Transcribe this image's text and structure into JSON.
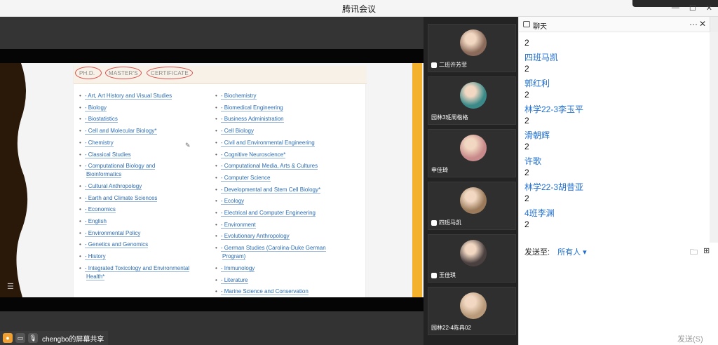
{
  "window": {
    "title": "腾讯会议"
  },
  "slide": {
    "tabs": [
      "PH.D.",
      "MASTER'S",
      "CERTIFICATE"
    ],
    "col1": [
      "- Art, Art History and Visual Studies",
      "- Biology",
      "- Biostatistics",
      "- Cell and Molecular Biology*",
      "- Chemistry",
      "- Classical Studies",
      "- Computational Biology and",
      "Bioinformatics",
      "- Cultural Anthropology",
      "- Earth and Climate Sciences",
      "- Economics",
      "- English",
      "- Environmental Policy",
      "- Genetics and Genomics",
      "- History",
      "- Integrated Toxicology and Environmental",
      "Health*"
    ],
    "col2": [
      "- Biochemistry",
      "- Biomedical Engineering",
      "- Business Administration",
      "- Cell Biology",
      "- Civil and Environmental Engineering",
      "- Cognitive Neuroscience*",
      "- Computational Media, Arts & Cultures",
      "- Computer Science",
      "- Developmental and Stem Cell Biology*",
      "- Ecology",
      "- Electrical and Computer Engineering",
      "- Environment",
      "- Evolutionary Anthropology",
      "- German Studies (Carolina-Duke German",
      "Program)",
      "- Immunology",
      "- Literature",
      "- Marine Science and Conservation"
    ]
  },
  "footer": {
    "share_label": "chengbo的屏幕共享"
  },
  "gallery": [
    {
      "name": "二班许芳菲",
      "muted": true,
      "color": "#8a6a5a"
    },
    {
      "name": "园林3班周楷格",
      "muted": false,
      "color": "#3a8a8a"
    },
    {
      "name": "申佳琦",
      "muted": false,
      "color": "#c88a8a"
    },
    {
      "name": "四班马凯",
      "muted": true,
      "color": "#9a7a5a"
    },
    {
      "name": "王佳琪",
      "muted": true,
      "color": "#4a4040"
    },
    {
      "name": "园林22-4陈冉02",
      "muted": false,
      "color": "#b89a7a"
    }
  ],
  "chat": {
    "title": "聊天",
    "messages": [
      {
        "kind": "text",
        "value": "2"
      },
      {
        "kind": "name",
        "value": "四班马凯"
      },
      {
        "kind": "text",
        "value": "2"
      },
      {
        "kind": "name",
        "value": "郭红利"
      },
      {
        "kind": "text",
        "value": "2"
      },
      {
        "kind": "name",
        "value": "林学22-3李玉平"
      },
      {
        "kind": "text",
        "value": "2"
      },
      {
        "kind": "name",
        "value": "滑朝辉"
      },
      {
        "kind": "text",
        "value": "2"
      },
      {
        "kind": "name",
        "value": "许歌"
      },
      {
        "kind": "text",
        "value": "2"
      },
      {
        "kind": "name",
        "value": "林学22-3胡昔亚"
      },
      {
        "kind": "text",
        "value": "2"
      },
      {
        "kind": "name",
        "value": "4班李渊"
      },
      {
        "kind": "text",
        "value": "2"
      }
    ],
    "send_to_label": "发送至:",
    "send_to_value": "所有人 ▾",
    "send_button": "发送(S)"
  }
}
